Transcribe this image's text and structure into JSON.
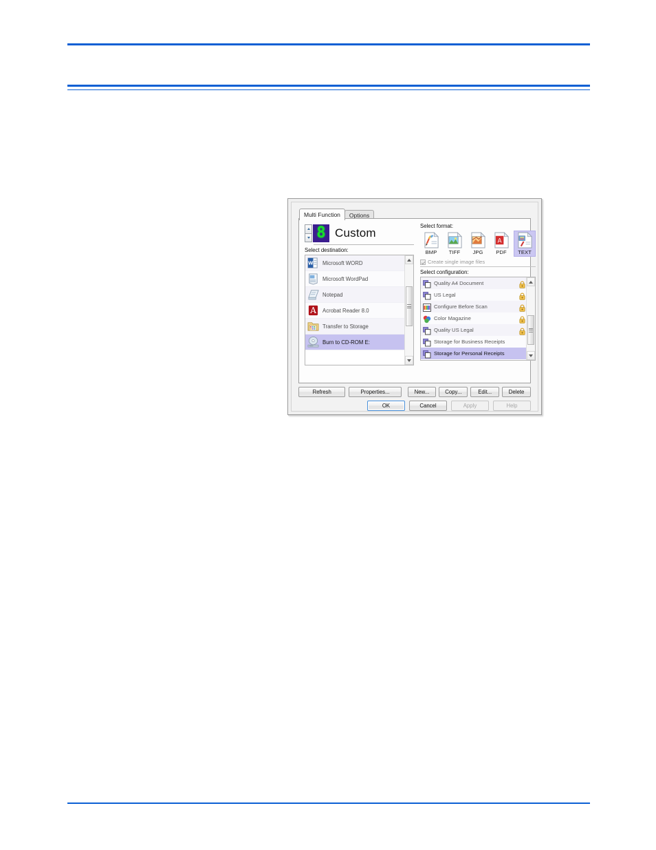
{
  "page": {
    "rules": [
      "top-rule",
      "mid-rule-thick",
      "mid-rule-thin",
      "bottom-rule"
    ],
    "rule_color": "#0b5fd4"
  },
  "dialog": {
    "tabs": [
      {
        "label": "Multi Function",
        "active": true
      },
      {
        "label": "Options",
        "active": false
      }
    ],
    "led_digit": "8",
    "led_background": "#3b1d8f",
    "led_color": "#17e02a",
    "destination_title": "Custom",
    "destination_label": "Select destination:",
    "destinations": [
      {
        "label": "Microsoft WORD",
        "icon": "word-icon",
        "selected": false
      },
      {
        "label": "Microsoft WordPad",
        "icon": "wordpad-icon",
        "selected": false
      },
      {
        "label": "Notepad",
        "icon": "notepad-icon",
        "selected": false
      },
      {
        "label": "Acrobat Reader 8.0",
        "icon": "acrobat-icon",
        "selected": false
      },
      {
        "label": "Transfer to Storage",
        "icon": "folder-icon",
        "selected": false
      },
      {
        "label": "Burn to CD-ROM  E:",
        "icon": "cd-burn-icon",
        "selected": true
      }
    ],
    "format_label": "Select format:",
    "formats": [
      {
        "label": "BMP",
        "icon": "bmp-doc-icon",
        "selected": false
      },
      {
        "label": "TIFF",
        "icon": "tiff-doc-icon",
        "selected": false
      },
      {
        "label": "JPG",
        "icon": "jpg-doc-icon",
        "selected": false
      },
      {
        "label": "PDF",
        "icon": "pdf-doc-icon",
        "selected": false
      },
      {
        "label": "TEXT",
        "icon": "text-doc-icon",
        "selected": true
      }
    ],
    "single_image_files": {
      "label": "Create single image files",
      "checked": true,
      "disabled": true
    },
    "configuration_label": "Select configuration:",
    "configurations": [
      {
        "label": "Quality A4 Document",
        "icon": "pages-icon",
        "locked": true,
        "selected": false
      },
      {
        "label": "US Legal",
        "icon": "pages-icon",
        "locked": true,
        "selected": false
      },
      {
        "label": "Configure Before Scan",
        "icon": "palette-icon",
        "locked": true,
        "selected": false
      },
      {
        "label": "Color Magazine",
        "icon": "color-icon",
        "locked": true,
        "selected": false
      },
      {
        "label": "Quality US Legal",
        "icon": "pages-icon",
        "locked": true,
        "selected": false
      },
      {
        "label": "Storage for Business Receipts",
        "icon": "pages-icon",
        "locked": false,
        "selected": false
      },
      {
        "label": "Storage for Personal Receipts",
        "icon": "pages-icon",
        "locked": false,
        "selected": true
      }
    ],
    "list_buttons": {
      "refresh": "Refresh",
      "properties": "Properties...",
      "new": "New...",
      "copy": "Copy...",
      "edit": "Edit...",
      "delete": "Delete"
    },
    "dialog_buttons": {
      "ok": "OK",
      "cancel": "Cancel",
      "apply": "Apply",
      "help": "Help"
    },
    "selection_color": "#c6c2f0"
  }
}
